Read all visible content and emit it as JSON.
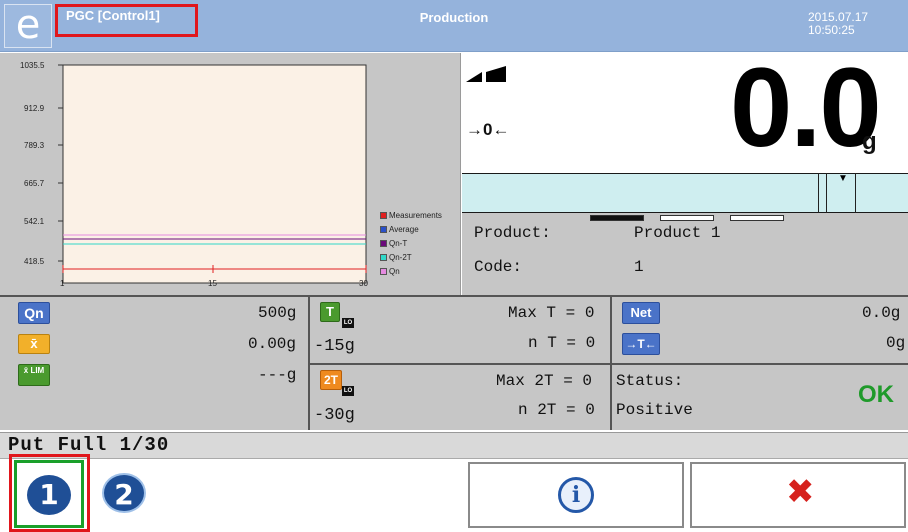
{
  "header": {
    "logo_letter": "e",
    "app_title": "PGC [Control1]",
    "screen_title": "Production",
    "date": "2015.07.17",
    "time": "10:50:25"
  },
  "chart": {
    "yticks": [
      "1035.5",
      "912.9",
      "789.3",
      "665.7",
      "542.1",
      "418.5"
    ],
    "xticks": [
      "1",
      "15",
      "30"
    ],
    "legend": [
      {
        "label": "Measurements",
        "color": "#e02020"
      },
      {
        "label": "Average",
        "color": "#2a50c8"
      },
      {
        "label": "Qn-T",
        "color": "#6a0a7a"
      },
      {
        "label": "Qn-2T",
        "color": "#30d8c8"
      },
      {
        "label": "Qn",
        "color": "#e58be0"
      }
    ]
  },
  "weight": {
    "value": "0.0",
    "unit": "g",
    "zero_indicator": "→0←"
  },
  "product": {
    "product_label": "Product:",
    "product_value": "Product 1",
    "code_label": "Code:",
    "code_value": "1"
  },
  "stats": {
    "qn_badge": "Qn",
    "qn_value": "500g",
    "avg_badge": "x̄",
    "avg_value": "0.00g",
    "lim_badge": "x̄ LIM",
    "lim_value": "---g",
    "t_badge": "T",
    "t_value": "-15g",
    "t2_badge": "2T",
    "t2_value": "-30g",
    "lo_label": "LO",
    "max_t": "Max T = 0",
    "n_t": "n T = 0",
    "max_2t": "Max 2T = 0",
    "n_2t": "n 2T = 0",
    "net_badge": "Net",
    "net_value": "0.0g",
    "tare_badge": "→T←",
    "tare_value": "0g",
    "status_label": "Status:",
    "status_value": "Positive",
    "status_ok": "OK"
  },
  "putfull": "Put Full 1/30",
  "buttons": {
    "btn1": "1",
    "btn2": "2",
    "info": "i",
    "close": "✖"
  }
}
